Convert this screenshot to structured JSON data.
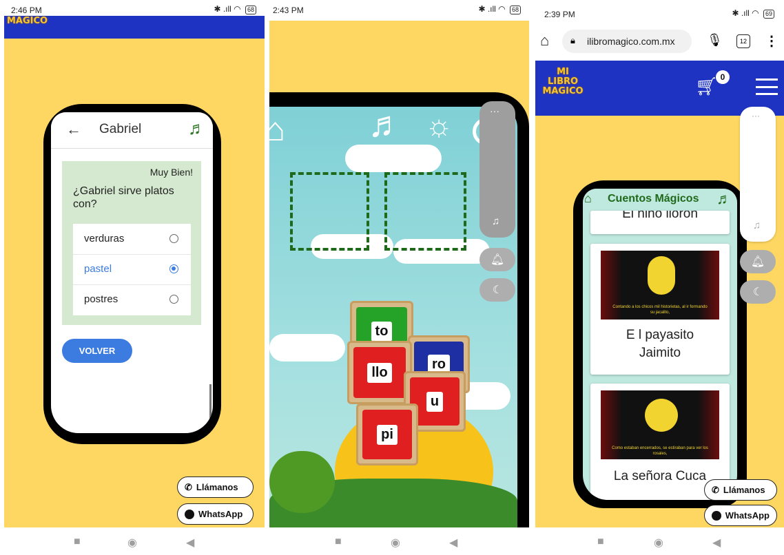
{
  "panel1": {
    "status_time": "2:46 PM",
    "battery": "68",
    "logo_text": "MAGICO",
    "header_title": "Gabriel",
    "feedback": "Muy Bien!",
    "question": "¿Gabriel sirve platos con?",
    "options": [
      {
        "label": "verduras",
        "selected": false
      },
      {
        "label": "pastel",
        "selected": true
      },
      {
        "label": "postres",
        "selected": false
      }
    ],
    "back_button": "VOLVER",
    "call_button": "Llámanos",
    "whatsapp_button": "WhatsApp"
  },
  "panel2": {
    "status_time": "2:43 PM",
    "battery": "68",
    "cubes": [
      {
        "label": "to",
        "color": "#24a328"
      },
      {
        "label": "ro",
        "color": "#1d2fa3"
      },
      {
        "label": "llo",
        "color": "#e02020"
      },
      {
        "label": "u",
        "color": "#e02020"
      },
      {
        "label": "pi",
        "color": "#e02020"
      }
    ]
  },
  "panel3": {
    "status_time": "2:39 PM",
    "battery": "69",
    "url": "ilibromagico.com.mx",
    "tab_count": "12",
    "logo_lines": [
      "MI",
      "LIBRO",
      "MAGICO"
    ],
    "cart_count": "0",
    "inner_title": "Cuentos Mágicos",
    "stories": [
      {
        "title": "El niño llorón",
        "caption": ""
      },
      {
        "title": "E l payasito Jaimito",
        "caption": "Contando a los chicos mil historietas, al ir formando su jacalito,"
      },
      {
        "title": "La señora Cuca",
        "caption": "Como estaban encerrados, se estiraban para ver los rosales,"
      }
    ],
    "call_button": "Llámanos",
    "whatsapp_button": "WhatsApp"
  },
  "colors": {
    "page_yellow": "#fed762",
    "brand_blue": "#1f33c3",
    "accent_blue": "#3c7be0",
    "green_dark": "#1f6a1a",
    "quiz_green": "#d5e9d0"
  }
}
